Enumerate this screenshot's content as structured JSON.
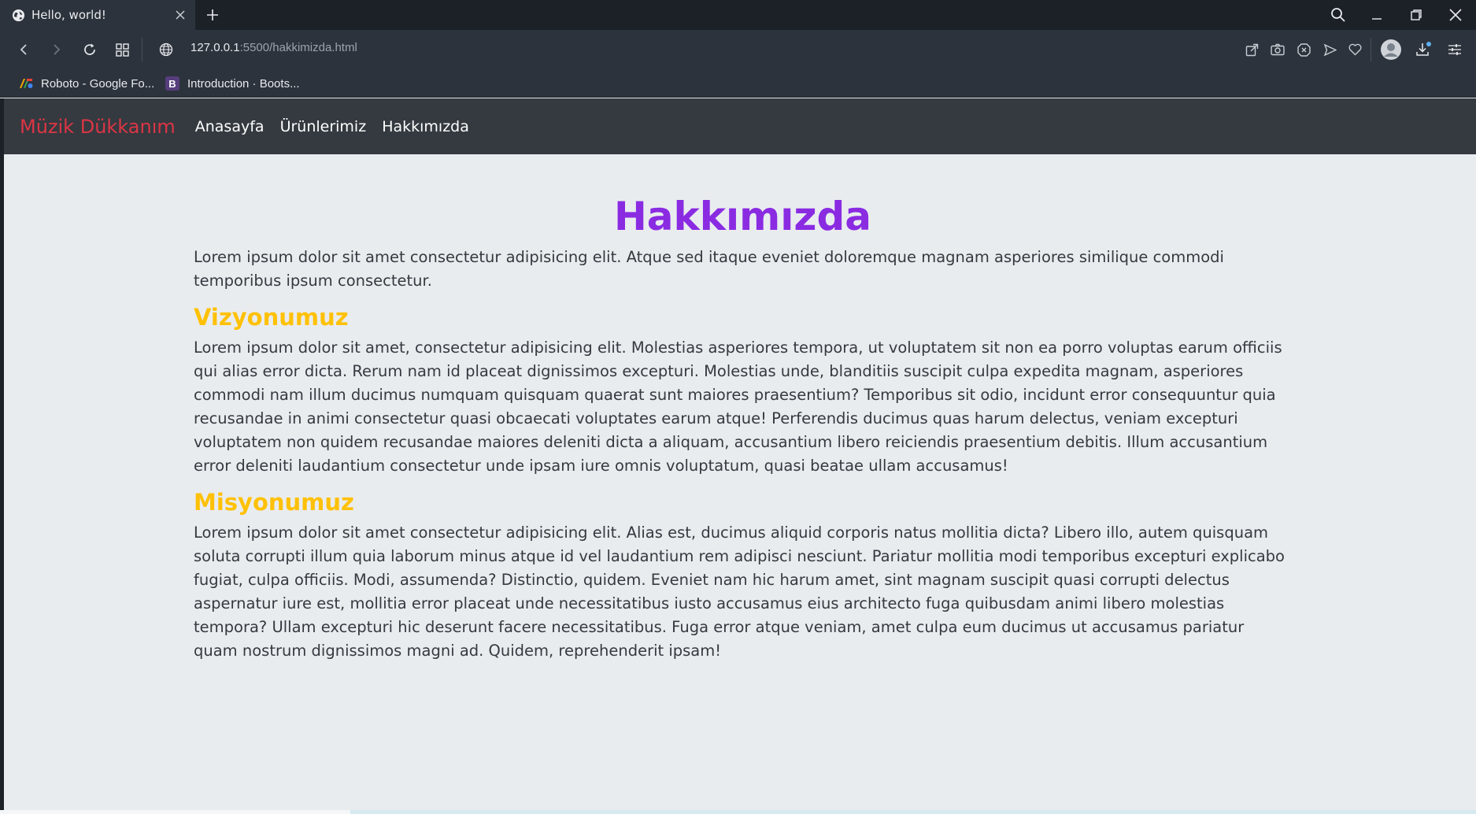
{
  "browser": {
    "tab_title": "Hello, world!",
    "url_host": "127.0.0.1",
    "url_path": ":5500/hakkimizda.html",
    "bookmarks": [
      {
        "label": "Roboto - Google Fo...",
        "icon": "google-fonts-icon"
      },
      {
        "label": "Introduction · Boots...",
        "icon": "bootstrap-icon",
        "icon_glyph": "B"
      }
    ]
  },
  "navbar": {
    "brand": "Müzik Dükkanım",
    "links": [
      "Anasayfa",
      "Ürünlerimiz",
      "Hakkımızda"
    ]
  },
  "main": {
    "title": "Hakkımızda",
    "intro": "Lorem ipsum dolor sit amet consectetur adipisicing elit. Atque sed itaque eveniet doloremque magnam asperiores similique commodi temporibus ipsum consectetur.",
    "sections": [
      {
        "heading": "Vizyonumuz",
        "text": "Lorem ipsum dolor sit amet, consectetur adipisicing elit. Molestias asperiores tempora, ut voluptatem sit non ea porro voluptas earum officiis qui alias error dicta. Rerum nam id placeat dignissimos excepturi. Molestias unde, blanditiis suscipit culpa expedita magnam, asperiores commodi nam illum ducimus numquam quisquam quaerat sunt maiores praesentium? Temporibus sit odio, incidunt error consequuntur quia recusandae in animi consectetur quasi obcaecati voluptates earum atque! Perferendis ducimus quas harum delectus, veniam excepturi voluptatem non quidem recusandae maiores deleniti dicta a aliquam, accusantium libero reiciendis praesentium debitis. Illum accusantium error deleniti laudantium consectetur unde ipsam iure omnis voluptatum, quasi beatae ullam accusamus!"
      },
      {
        "heading": "Misyonumuz",
        "text": "Lorem ipsum dolor sit amet consectetur adipisicing elit. Alias est, ducimus aliquid corporis natus mollitia dicta? Libero illo, autem quisquam soluta corrupti illum quia laborum minus atque id vel laudantium rem adipisci nesciunt. Pariatur mollitia modi temporibus excepturi explicabo fugiat, culpa officiis. Modi, assumenda? Distinctio, quidem. Eveniet nam hic harum amet, sint magnam suscipit quasi corrupti delectus aspernatur iure est, mollitia error placeat unde necessitatibus iusto accusamus eius architecto fuga quibusdam animi libero molestias tempora? Ullam excepturi hic deserunt facere necessitatibus. Fuga error atque veniam, amet culpa eum ducimus ut accusamus pariatur quam nostrum dignissimos magni ad. Quidem, reprehenderit ipsam!"
      }
    ]
  },
  "colors": {
    "brand": "#dc3545",
    "title": "#8a2be2",
    "section_heading": "#ffc107",
    "navbar_bg": "#343a40",
    "page_bg": "#e9ecef"
  }
}
